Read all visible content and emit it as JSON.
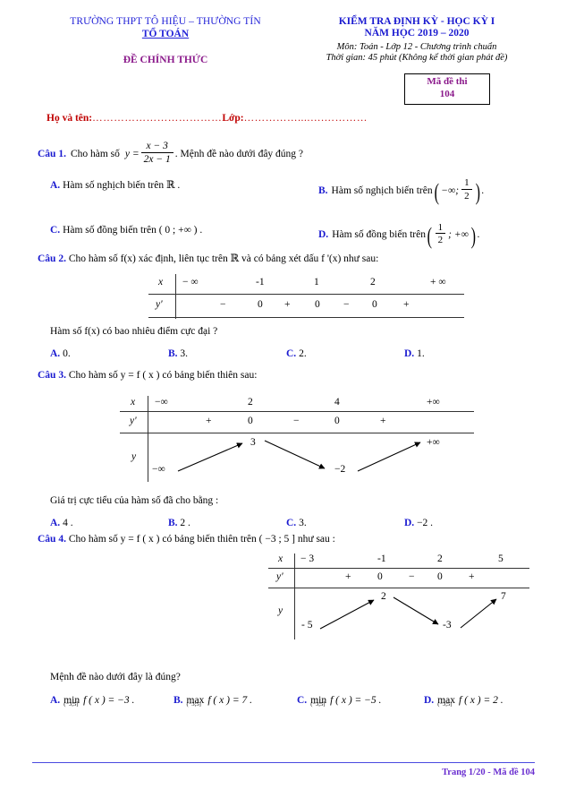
{
  "header": {
    "school": "TRƯỜNG THPT TÔ HIỆU – THƯỜNG TÍN",
    "department": "TỔ TOÁN",
    "official": "ĐỀ CHÍNH THỨC",
    "exam_title_line1": "KIỂM TRA ĐỊNH KỲ - HỌC KỲ I",
    "exam_title_line2": "NĂM HỌC 2019 – 2020",
    "subject_line": "Môn: Toán - Lớp 12 - Chương trình chuẩn",
    "time_line": "Thời gian: 45 phút (Không kể thời gian phát đề)",
    "code_label": "Mã đề thi",
    "code_number": "104",
    "name_label": "Họ và tên:",
    "name_dots": "………………………………",
    "class_label": "Lớp:",
    "class_dots": "……………....….…………"
  },
  "questions": [
    {
      "label": "Câu 1.",
      "stem_before": "Cho hàm số",
      "stem_y": "y =",
      "frac_num": "x − 3",
      "frac_den": "2x − 1",
      "stem_after": ". Mệnh đề nào dưới đây đúng ?",
      "options": [
        {
          "letter": "A.",
          "text": "Hàm số nghịch biến trên ℝ ."
        },
        {
          "letter": "B.",
          "text": "Hàm số nghịch biến trên",
          "interval_pre": "−∞;",
          "frac_num": "1",
          "frac_den": "2",
          "interval_post": "",
          "tail": "."
        },
        {
          "letter": "C.",
          "text": "Hàm số đồng biến trên ( 0 ; +∞ ) ."
        },
        {
          "letter": "D.",
          "text": "Hàm số đồng biến trên",
          "interval_pre": "",
          "frac_num": "1",
          "frac_den": "2",
          "interval_post": "; +∞",
          "tail": "."
        }
      ]
    },
    {
      "label": "Câu 2.",
      "stem": "Cho hàm số  f(x)  xác định, liên tục trên ℝ và có bảng xét dấu  f '(x)  như sau:",
      "table": {
        "row_x_label": "x",
        "row_yp_label": "y'",
        "x_values": [
          "− ∞",
          "-1",
          "1",
          "2",
          "+ ∞"
        ],
        "sign_values": [
          "−",
          "0",
          "+",
          "0",
          "−",
          "0",
          "+"
        ]
      },
      "subquestion": "Hàm số  f(x)  có bao nhiêu điểm cực đại ?",
      "options": [
        {
          "letter": "A.",
          "text": "0."
        },
        {
          "letter": "B.",
          "text": "3."
        },
        {
          "letter": "C.",
          "text": "2."
        },
        {
          "letter": "D.",
          "text": "1."
        }
      ]
    },
    {
      "label": "Câu 3.",
      "stem": "Cho hàm số  y = f ( x )  có bảng biến thiên sau:",
      "table": {
        "row_x_label": "x",
        "row_yp_label": "y'",
        "row_y_label": "y",
        "x_values": [
          "−∞",
          "2",
          "4",
          "+∞"
        ],
        "sign_values": [
          "+",
          "0",
          "−",
          "0",
          "+"
        ],
        "y_values": [
          "−∞",
          "3",
          "−2",
          "+∞"
        ]
      },
      "subquestion": "Giá trị cực tiểu của hàm số đã cho bằng :",
      "options": [
        {
          "letter": "A.",
          "text": "4 ."
        },
        {
          "letter": "B.",
          "text": "2 ."
        },
        {
          "letter": "C.",
          "text": "3."
        },
        {
          "letter": "D.",
          "text": "−2 ."
        }
      ]
    },
    {
      "label": "Câu 4.",
      "stem": "Cho hàm số  y = f ( x ) có bảng biến thiên trên ( −3 ; 5 ]  như sau :",
      "table": {
        "row_x_label": "x",
        "row_yp_label": "y'",
        "row_y_label": "y",
        "x_values": [
          "− 3",
          "-1",
          "2",
          "5"
        ],
        "sign_values": [
          "+",
          "0",
          "−",
          "0",
          "+"
        ],
        "y_values": [
          "- 5",
          "2",
          "-3",
          "7"
        ]
      },
      "subquestion": "Mệnh đề nào dưới đây là đúng?",
      "options": [
        {
          "letter": "A.",
          "op": "min",
          "sub": "(−3;5]",
          "body": "f ( x ) = −3 ."
        },
        {
          "letter": "B.",
          "op": "max",
          "sub": "(−3;5]",
          "body": "f ( x ) = 7 ."
        },
        {
          "letter": "C.",
          "op": "min",
          "sub": "(−3;5]",
          "body": "f ( x ) = −5 ."
        },
        {
          "letter": "D.",
          "op": "max",
          "sub": "(−3;5]",
          "body": "f ( x ) = 2 ."
        }
      ]
    }
  ],
  "footer": {
    "text": "Trang 1/20 - Mã đề 104"
  },
  "colors": {
    "heading_blue": "#1a1ad0",
    "purple": "#8b1a8b",
    "red": "#c00000",
    "footer_purple": "#6a2fd0"
  }
}
